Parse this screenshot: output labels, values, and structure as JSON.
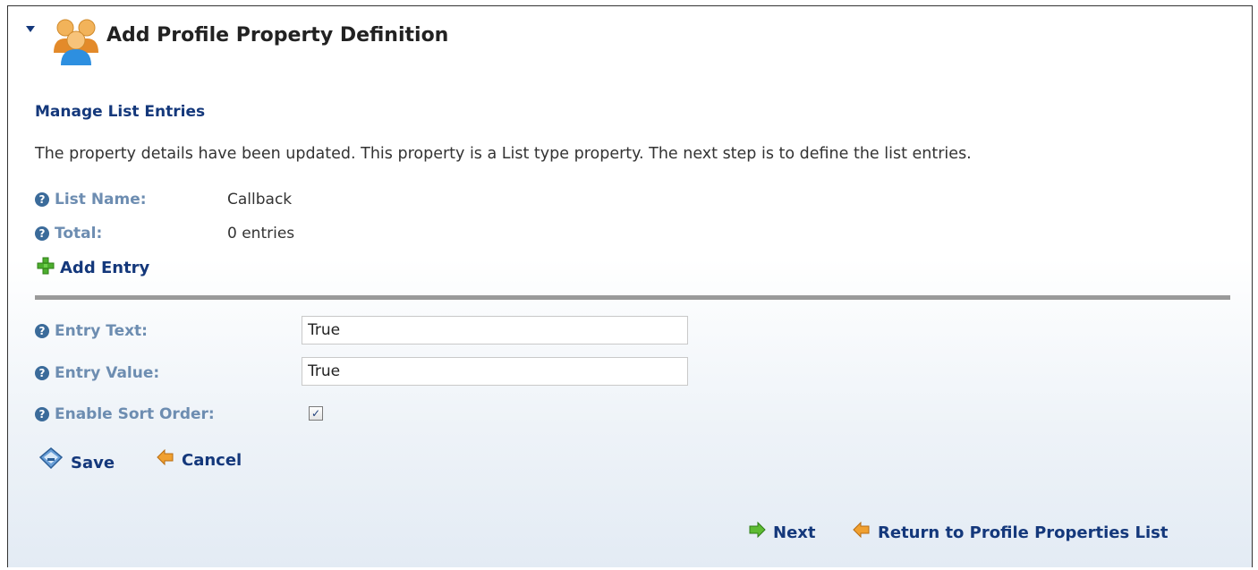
{
  "header": {
    "title": "Add Profile Property Definition"
  },
  "section_title": "Manage List Entries",
  "description": "The property details have been updated. This property is a List type property. The next step is to define the list entries.",
  "list_info": {
    "list_name_label": "List Name:",
    "list_name_value": "Callback",
    "total_label": "Total:",
    "total_value": "0 entries"
  },
  "add_entry_label": "Add Entry",
  "form": {
    "entry_text_label": "Entry Text:",
    "entry_text_value": "True",
    "entry_value_label": "Entry Value:",
    "entry_value_value": "True",
    "enable_sort_label": "Enable Sort Order:",
    "enable_sort_checked": true
  },
  "actions": {
    "save_label": "Save",
    "cancel_label": "Cancel"
  },
  "footer": {
    "next_label": "Next",
    "return_label": "Return to Profile Properties List"
  },
  "icons": {
    "collapse": "chevron-down-icon",
    "users": "users-icon",
    "help": "help-icon",
    "add": "plus-icon",
    "save": "save-icon",
    "cancel": "back-arrow-icon",
    "next": "forward-arrow-icon",
    "return": "back-arrow-icon"
  },
  "colors": {
    "heading_blue": "#14387b",
    "label_blue": "#6d8db1",
    "divider": "#9a9a9a"
  }
}
